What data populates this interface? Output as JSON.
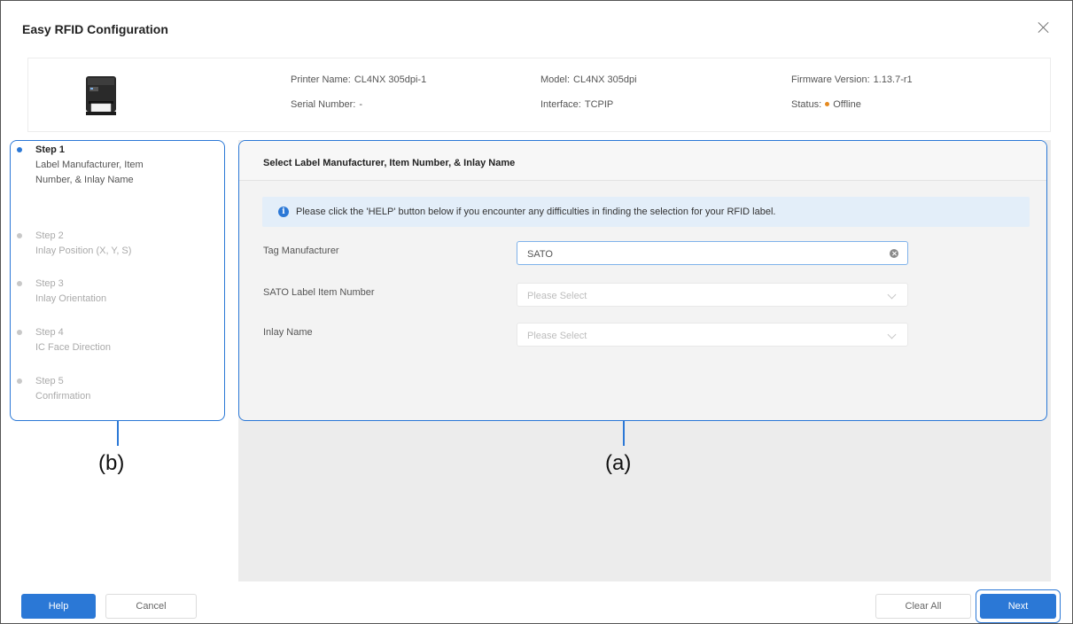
{
  "window": {
    "title": "Easy RFID Configuration"
  },
  "printer": {
    "name_label": "Printer Name:",
    "name_value": "CL4NX 305dpi-1",
    "serial_label": "Serial Number:",
    "serial_value": "-",
    "model_label": "Model:",
    "model_value": "CL4NX 305dpi",
    "interface_label": "Interface:",
    "interface_value": "TCPIP",
    "firmware_label": "Firmware Version:",
    "firmware_value": "1.13.7-r1",
    "status_label": "Status:",
    "status_value": "Offline",
    "status_color": "#e58a1f"
  },
  "steps": [
    {
      "title": "Step 1",
      "desc": "Label Manufacturer, Item Number, & Inlay Name",
      "active": true
    },
    {
      "title": "Step 2",
      "desc": "Inlay Position (X, Y, S)",
      "active": false
    },
    {
      "title": "Step 3",
      "desc": "Inlay Orientation",
      "active": false
    },
    {
      "title": "Step 4",
      "desc": "IC Face Direction",
      "active": false
    },
    {
      "title": "Step 5",
      "desc": "Confirmation",
      "active": false
    }
  ],
  "panel": {
    "title": "Select Label Manufacturer, Item Number, & Inlay Name",
    "notice": "Please click the 'HELP' button below if you encounter any difficulties in finding the selection for your RFID label.",
    "notice_icon": "info-icon",
    "fields": {
      "tag_manufacturer": {
        "label": "Tag Manufacturer",
        "value": "SATO"
      },
      "item_number": {
        "label": "SATO Label Item Number",
        "placeholder": "Please Select"
      },
      "inlay_name": {
        "label": "Inlay Name",
        "placeholder": "Please Select"
      }
    }
  },
  "callouts": {
    "a": "(a)",
    "b": "(b)"
  },
  "footer": {
    "help": "Help",
    "cancel": "Cancel",
    "clear_all": "Clear All",
    "next": "Next"
  },
  "colors": {
    "accent": "#2b78d6",
    "panel_bg": "#ececec",
    "notice_bg": "#e3eef9"
  }
}
